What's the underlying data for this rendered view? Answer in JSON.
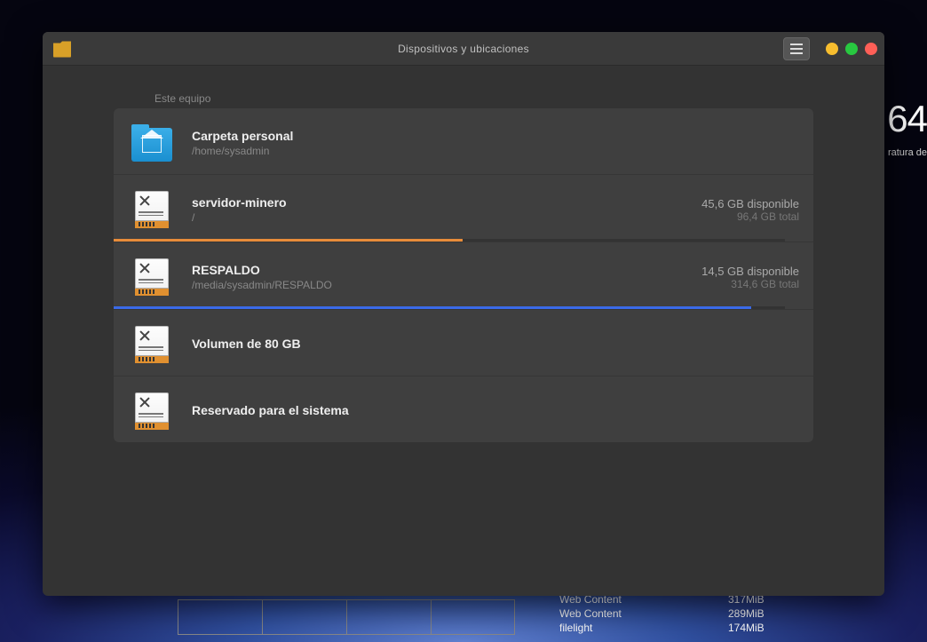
{
  "window": {
    "title": "Dispositivos y ubicaciones"
  },
  "section_label": "Este equipo",
  "entries": {
    "home": {
      "name": "Carpeta personal",
      "path": "/home/sysadmin"
    },
    "root": {
      "name": "servidor-minero",
      "path": "/",
      "available": "45,6 GB disponible",
      "total": "96,4 GB total",
      "used_pct": 52
    },
    "respaldo": {
      "name": "RESPALDO",
      "path": "/media/sysadmin/RESPALDO",
      "available": "14,5 GB disponible",
      "total": "314,6 GB total",
      "used_pct": 95
    },
    "vol80": {
      "name": "Volumen de 80 GB"
    },
    "reserved": {
      "name": "Reservado para el sistema"
    }
  },
  "desktop": {
    "big": "64",
    "small": "ratura de",
    "processes": [
      {
        "name": "Web Content",
        "mem": "317MiB"
      },
      {
        "name": "Web Content",
        "mem": "289MiB"
      },
      {
        "name": "filelight",
        "mem": "174MiB"
      }
    ]
  }
}
